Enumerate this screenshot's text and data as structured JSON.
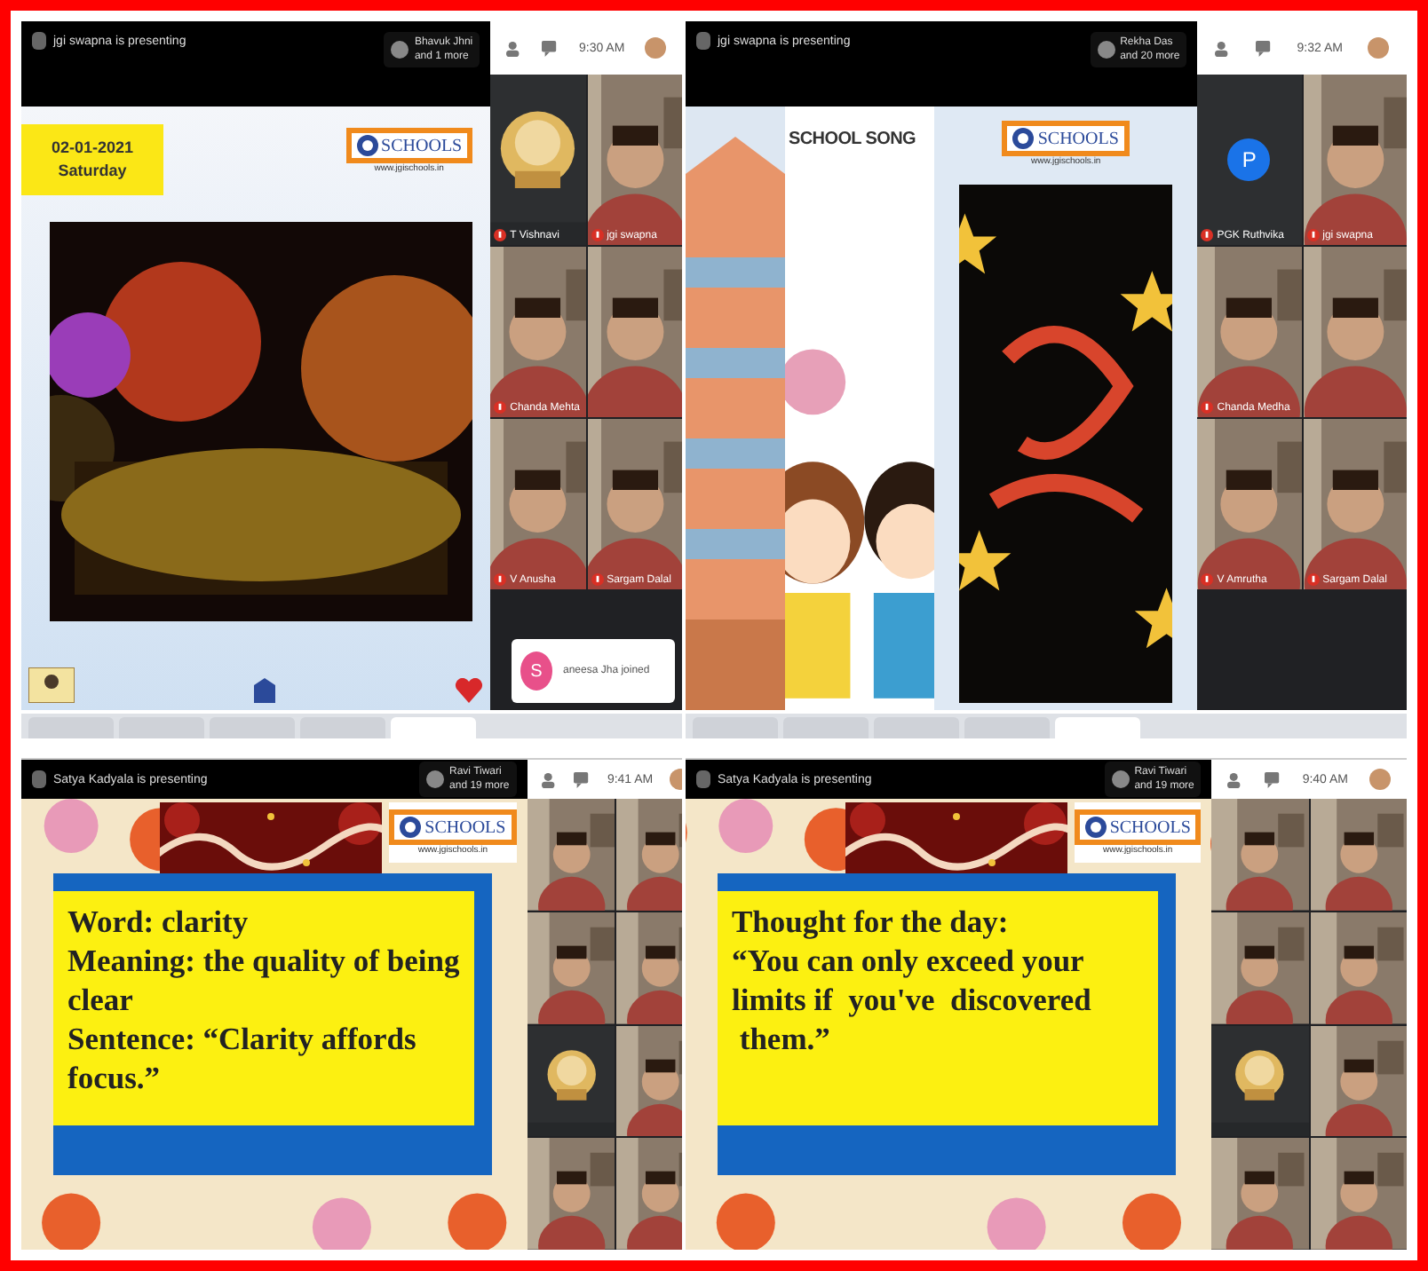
{
  "panels": [
    {
      "kind": "meet",
      "presenter": "jgi swapna is presenting",
      "viewers": [
        "Bhavuk Jhni",
        "and 1 more"
      ],
      "time": "9:30 AM",
      "slide": {
        "kind": "date",
        "date": "02-01-2021",
        "day": "Saturday",
        "logo": "SCHOOLS",
        "url": "www.jgischools.in"
      },
      "tiles": [
        {
          "kind": "avatar",
          "name": "T Vishnavi"
        },
        {
          "kind": "video",
          "name": "jgi swapna"
        },
        {
          "kind": "video",
          "name": "Chanda Mehta"
        },
        {
          "kind": "video"
        },
        {
          "kind": "video",
          "name": "V Anusha"
        },
        {
          "kind": "video",
          "name": "Sargam Dalal"
        }
      ],
      "toast": {
        "initial": "S",
        "text": "aneesa Jha joined"
      }
    },
    {
      "kind": "meet",
      "presenter": "jgi swapna is presenting",
      "viewers": [
        "Rekha Das",
        "and 20 more"
      ],
      "time": "9:32 AM",
      "slide": {
        "kind": "song",
        "title": "SCHOOL SONG",
        "logo": "SCHOOLS",
        "url": "www.jgischools.in"
      },
      "tiles": [
        {
          "kind": "avatar",
          "initial": "P",
          "name": "PGK Ruthvika"
        },
        {
          "kind": "video",
          "name": "jgi swapna"
        },
        {
          "kind": "video",
          "name": "Chanda Medha"
        },
        {
          "kind": "video"
        },
        {
          "kind": "video",
          "name": "V Amrutha"
        },
        {
          "kind": "video",
          "name": "Sargam Dalal"
        }
      ]
    },
    {
      "kind": "browser",
      "presenter": "Satya Kadyala is presenting",
      "viewers": [
        "Ravi Tiwari",
        "and 19 more"
      ],
      "time": "9:41 AM",
      "slide": {
        "kind": "text",
        "logo": "SCHOOLS",
        "url": "www.jgischools.in",
        "lines": [
          "Word: clarity",
          "Meaning: the quality of being",
          "clear",
          "Sentence: “Clarity affords",
          "focus.”"
        ]
      },
      "tiles": [
        {
          "kind": "video"
        },
        {
          "kind": "video"
        },
        {
          "kind": "video"
        },
        {
          "kind": "video"
        },
        {
          "kind": "avatar"
        },
        {
          "kind": "video"
        },
        {
          "kind": "video"
        },
        {
          "kind": "video"
        }
      ]
    },
    {
      "kind": "browser",
      "presenter": "Satya Kadyala is presenting",
      "viewers": [
        "Ravi Tiwari",
        "and 19 more"
      ],
      "time": "9:40 AM",
      "slide": {
        "kind": "text",
        "logo": "SCHOOLS",
        "url": "www.jgischools.in",
        "lines": [
          "Thought for the day:",
          "“You can only exceed your",
          "limits if  you've  discovered",
          " them.”"
        ]
      },
      "tiles": [
        {
          "kind": "video"
        },
        {
          "kind": "video"
        },
        {
          "kind": "video"
        },
        {
          "kind": "video"
        },
        {
          "kind": "avatar"
        },
        {
          "kind": "video"
        },
        {
          "kind": "video"
        },
        {
          "kind": "video"
        }
      ]
    }
  ]
}
